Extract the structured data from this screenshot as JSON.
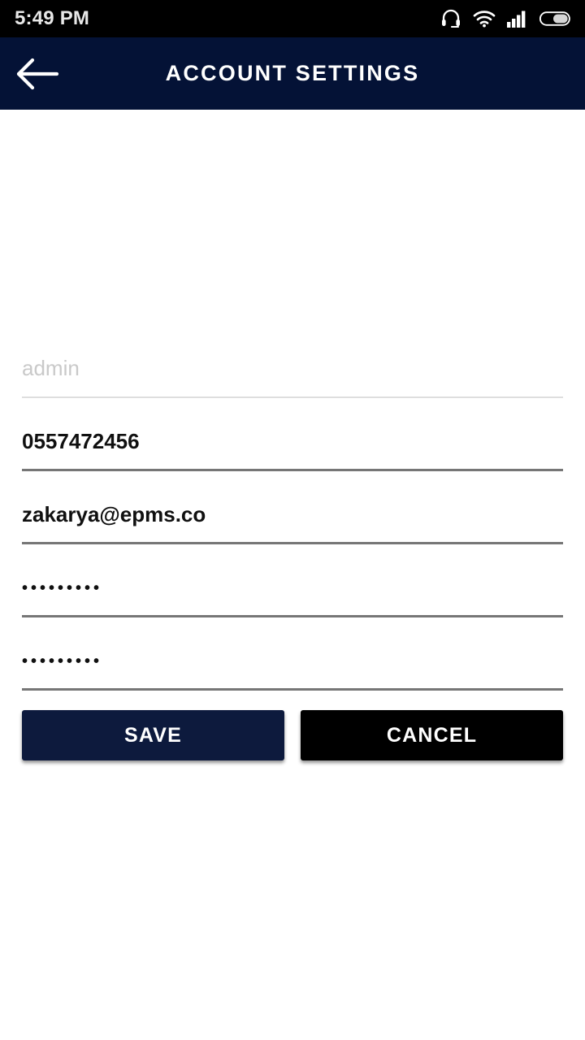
{
  "status_bar": {
    "time": "5:49 PM",
    "icons": [
      "headset-icon",
      "wifi-icon",
      "cellular-signal-icon",
      "battery-icon"
    ],
    "background_color": "#000000",
    "text_color": "#e8e8e8"
  },
  "app_bar": {
    "title": "ACCOUNT SETTINGS",
    "back_icon": "arrow-left-icon",
    "background_color": "#041236",
    "text_color": "#ffffff"
  },
  "form": {
    "fields": [
      {
        "name": "username",
        "value": "admin",
        "is_placeholder": true,
        "masked": false,
        "underline": "light"
      },
      {
        "name": "phone",
        "value": "0557472456",
        "is_placeholder": false,
        "masked": false,
        "underline": "normal"
      },
      {
        "name": "email",
        "value": "zakarya@epms.co",
        "is_placeholder": false,
        "masked": false,
        "underline": "normal"
      },
      {
        "name": "password",
        "value": "•••••••••",
        "is_placeholder": false,
        "masked": true,
        "underline": "normal"
      },
      {
        "name": "confirm-password",
        "value": "•••••••••",
        "is_placeholder": false,
        "masked": true,
        "underline": "normal"
      }
    ]
  },
  "actions": {
    "save_label": "SAVE",
    "cancel_label": "CANCEL",
    "save_color": "#0d1a3d",
    "cancel_color": "#000000"
  }
}
